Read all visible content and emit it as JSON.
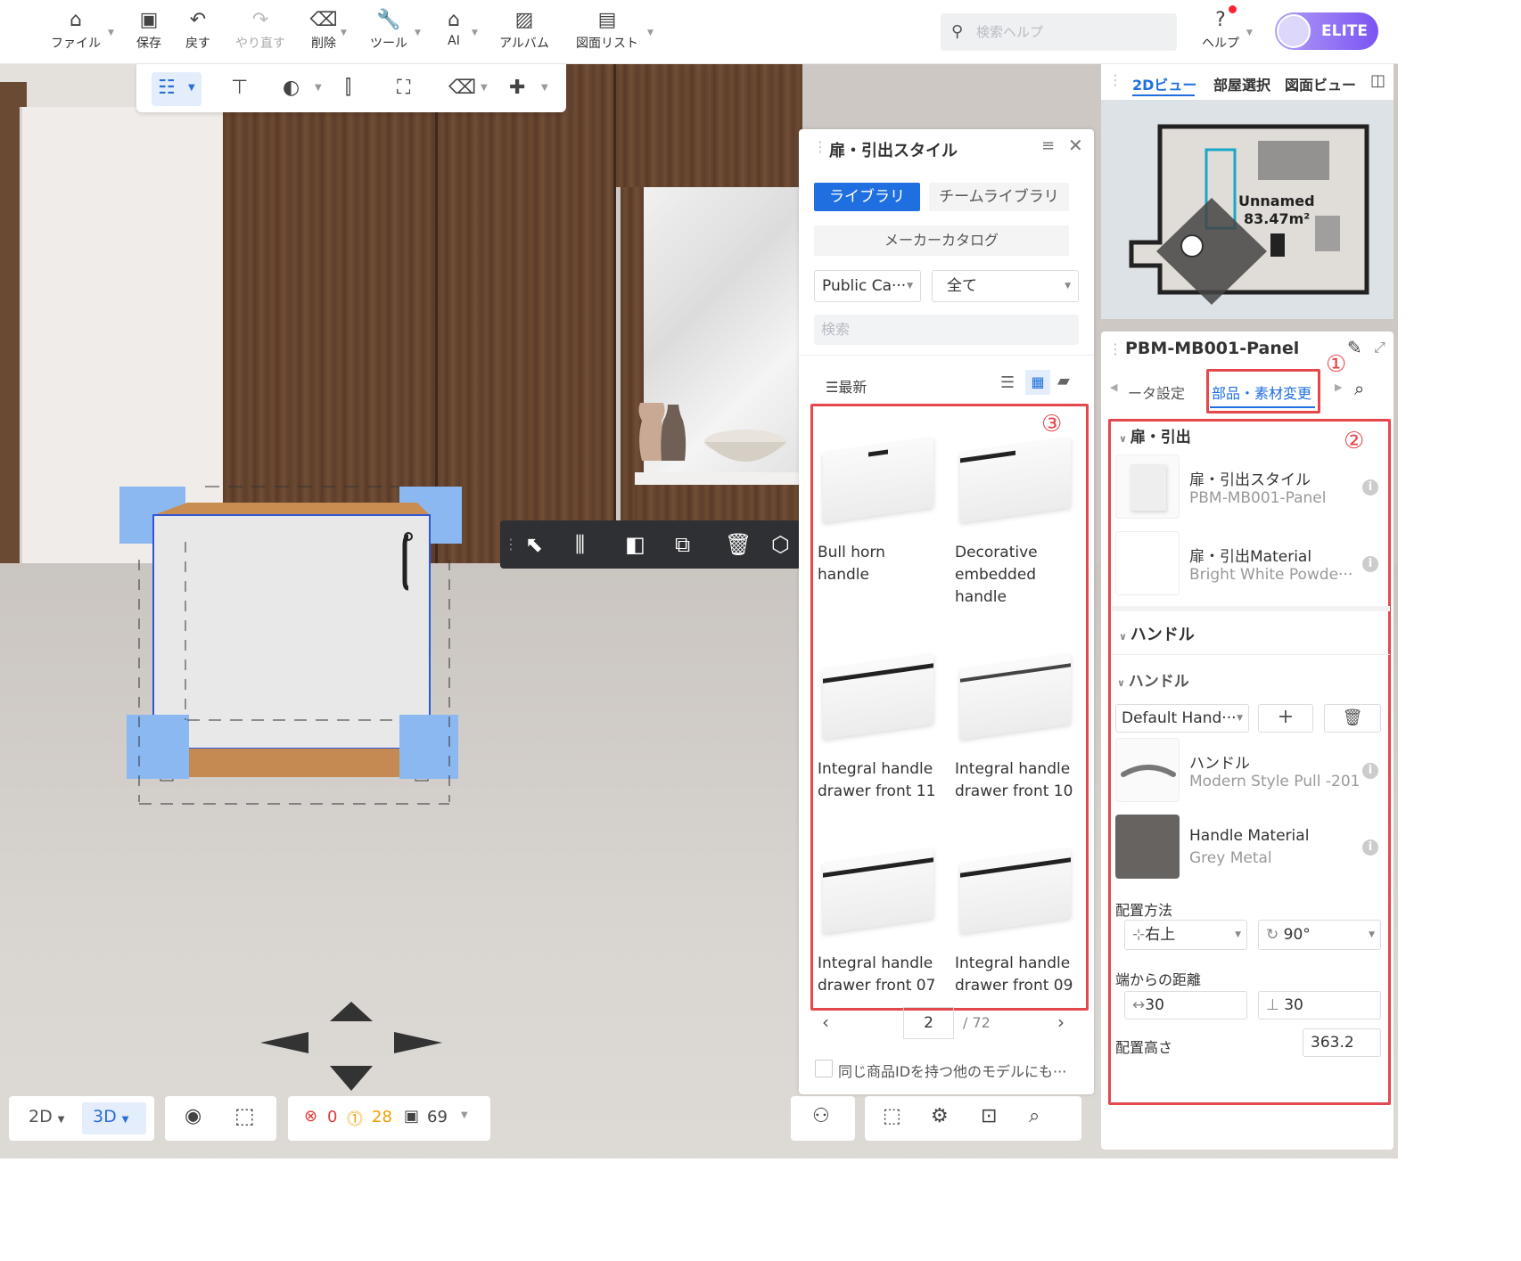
{
  "topbar": {
    "file": "ファイル",
    "save": "保存",
    "undo": "戻す",
    "redo": "やり直す",
    "delete": "削除",
    "tools": "ツール",
    "ai": "AI",
    "album": "アルバム",
    "drawing_list": "図面リスト",
    "search_placeholder": "検索ヘルプ",
    "help": "ヘルプ",
    "elite": "ELITE"
  },
  "minimap": {
    "tab_2d": "2Dビュー",
    "tab_room": "部屋選択",
    "tab_drawing": "図面ビュー",
    "room_name": "Unnamed",
    "room_area": "83.47m²"
  },
  "door_panel": {
    "title": "扉・引出スタイル",
    "tab_library": "ライブラリ",
    "tab_team": "チームライブラリ",
    "maker_catalog": "メーカーカタログ",
    "dd_catalog": "Public Ca···",
    "dd_all": "全て",
    "search_placeholder": "検索",
    "sort": "最新",
    "items": [
      {
        "name": "Bull horn handle"
      },
      {
        "name": "Decorative embedded handle"
      },
      {
        "name": "Integral handle drawer front 11"
      },
      {
        "name": "Integral handle drawer front 10"
      },
      {
        "name": "Integral handle drawer front 07"
      },
      {
        "name": "Integral handle drawer front 09"
      }
    ],
    "page": "2",
    "total": "/ 72",
    "same_id": "同じ商品IDを持つ他のモデルにも···",
    "marker": "③"
  },
  "props": {
    "title": "PBM-MB001-Panel",
    "tab_param": "ータ設定",
    "tab_parts": "部品・素材変更",
    "marker1": "①",
    "marker2": "②",
    "sec_door": "扉・引出",
    "door_style_label": "扉・引出スタイル",
    "door_style_value": "PBM-MB001-Panel",
    "door_mat_label": "扉・引出Material",
    "door_mat_value": "Bright White Powde···",
    "sec_handle": "ハンドル",
    "sub_handle": "ハンドル",
    "handle_dd": "Default Hand···",
    "handle_label": "ハンドル",
    "handle_value": "Modern Style Pull -201",
    "handle_mat_label": "Handle Material",
    "handle_mat_value": "Grey Metal",
    "placement": "配置方法",
    "placement_pos": "右上",
    "placement_angle": "90°",
    "edge_dist": "端からの距離",
    "edge_x": "30",
    "edge_y": "30",
    "height_label": "配置高さ",
    "height_value": "363.2"
  },
  "bottom": {
    "view_2d": "2D",
    "view_3d": "3D",
    "err": "0",
    "warn": "28",
    "count": "69"
  }
}
